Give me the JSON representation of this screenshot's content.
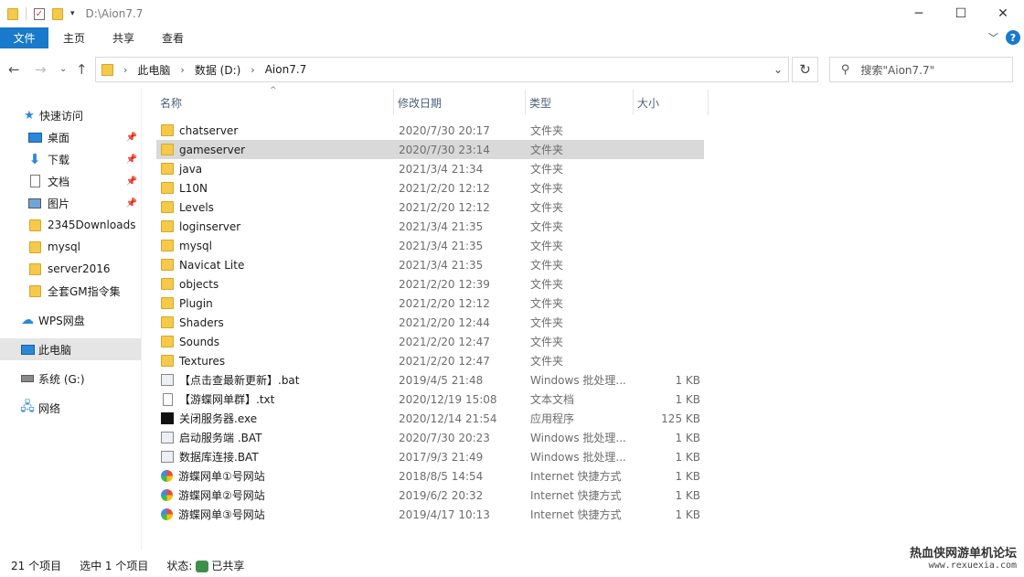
{
  "window": {
    "title": "D:\\Aion7.7",
    "controls": {
      "minimize": "─",
      "maximize": "☐",
      "close": "✕"
    }
  },
  "ribbon": {
    "file_tab": "文件",
    "tabs": [
      "主页",
      "共享",
      "查看"
    ]
  },
  "address": {
    "crumbs": [
      "此电脑",
      "数据 (D:)",
      "Aion7.7"
    ],
    "search_placeholder": "搜索\"Aion7.7\""
  },
  "sidebar": {
    "items": [
      {
        "label": "快速访问",
        "icon": "star-icon"
      },
      {
        "label": "桌面",
        "icon": "desktop-icon",
        "pinned": true
      },
      {
        "label": "下载",
        "icon": "download-icon",
        "pinned": true
      },
      {
        "label": "文档",
        "icon": "document-icon",
        "pinned": true
      },
      {
        "label": "图片",
        "icon": "picture-icon",
        "pinned": true
      },
      {
        "label": "2345Downloads",
        "icon": "folder-icon"
      },
      {
        "label": "mysql",
        "icon": "folder-icon"
      },
      {
        "label": "server2016",
        "icon": "folder-icon"
      },
      {
        "label": "全套GM指令集",
        "icon": "folder-icon"
      },
      {
        "label": "WPS网盘",
        "icon": "cloud-icon"
      },
      {
        "label": "此电脑",
        "icon": "computer-icon",
        "selected": true
      },
      {
        "label": "系统 (G:)",
        "icon": "drive-icon"
      },
      {
        "label": "网络",
        "icon": "network-icon"
      }
    ]
  },
  "columns": {
    "name": "名称",
    "date": "修改日期",
    "type": "类型",
    "size": "大小"
  },
  "files": [
    {
      "name": "chatserver",
      "date": "2020/7/30 20:17",
      "type": "文件夹",
      "size": "",
      "icon": "folder"
    },
    {
      "name": "gameserver",
      "date": "2020/7/30 23:14",
      "type": "文件夹",
      "size": "",
      "icon": "folder",
      "selected": true
    },
    {
      "name": "java",
      "date": "2021/3/4 21:34",
      "type": "文件夹",
      "size": "",
      "icon": "folder"
    },
    {
      "name": "L10N",
      "date": "2021/2/20 12:12",
      "type": "文件夹",
      "size": "",
      "icon": "folder"
    },
    {
      "name": "Levels",
      "date": "2021/2/20 12:12",
      "type": "文件夹",
      "size": "",
      "icon": "folder"
    },
    {
      "name": "loginserver",
      "date": "2021/3/4 21:35",
      "type": "文件夹",
      "size": "",
      "icon": "folder"
    },
    {
      "name": "mysql",
      "date": "2021/3/4 21:35",
      "type": "文件夹",
      "size": "",
      "icon": "folder"
    },
    {
      "name": "Navicat Lite",
      "date": "2021/3/4 21:35",
      "type": "文件夹",
      "size": "",
      "icon": "folder"
    },
    {
      "name": "objects",
      "date": "2021/2/20 12:39",
      "type": "文件夹",
      "size": "",
      "icon": "folder"
    },
    {
      "name": "Plugin",
      "date": "2021/2/20 12:12",
      "type": "文件夹",
      "size": "",
      "icon": "folder"
    },
    {
      "name": "Shaders",
      "date": "2021/2/20 12:44",
      "type": "文件夹",
      "size": "",
      "icon": "folder"
    },
    {
      "name": "Sounds",
      "date": "2021/2/20 12:47",
      "type": "文件夹",
      "size": "",
      "icon": "folder"
    },
    {
      "name": "Textures",
      "date": "2021/2/20 12:47",
      "type": "文件夹",
      "size": "",
      "icon": "folder"
    },
    {
      "name": "【点击查最新更新】.bat",
      "date": "2019/4/5 21:48",
      "type": "Windows 批处理...",
      "size": "1 KB",
      "icon": "bat"
    },
    {
      "name": "【游蝶网单群】.txt",
      "date": "2020/12/19 15:08",
      "type": "文本文档",
      "size": "1 KB",
      "icon": "txt"
    },
    {
      "name": "关闭服务器.exe",
      "date": "2020/12/14 21:54",
      "type": "应用程序",
      "size": "125 KB",
      "icon": "exe"
    },
    {
      "name": "启动服务端 .BAT",
      "date": "2020/7/30 20:23",
      "type": "Windows 批处理...",
      "size": "1 KB",
      "icon": "bat"
    },
    {
      "name": "数据库连接.BAT",
      "date": "2017/9/3 21:49",
      "type": "Windows 批处理...",
      "size": "1 KB",
      "icon": "bat"
    },
    {
      "name": "游蝶网单①号网站",
      "date": "2018/8/5 14:54",
      "type": "Internet 快捷方式",
      "size": "1 KB",
      "icon": "url"
    },
    {
      "name": "游蝶网单②号网站",
      "date": "2019/6/2 20:32",
      "type": "Internet 快捷方式",
      "size": "1 KB",
      "icon": "url"
    },
    {
      "name": "游蝶网单③号网站",
      "date": "2019/4/17 10:13",
      "type": "Internet 快捷方式",
      "size": "1 KB",
      "icon": "url"
    }
  ],
  "status": {
    "count": "21 个项目",
    "selected": "选中 1 个项目",
    "state_label": "状态:",
    "state_value": "已共享"
  },
  "watermark": {
    "line1": "热血侠网游单机论坛",
    "line2": "www.rexuexia.com"
  },
  "colors": {
    "accent": "#1979ca",
    "folder": "#f5c94a",
    "selection": "#d9d9d9"
  }
}
